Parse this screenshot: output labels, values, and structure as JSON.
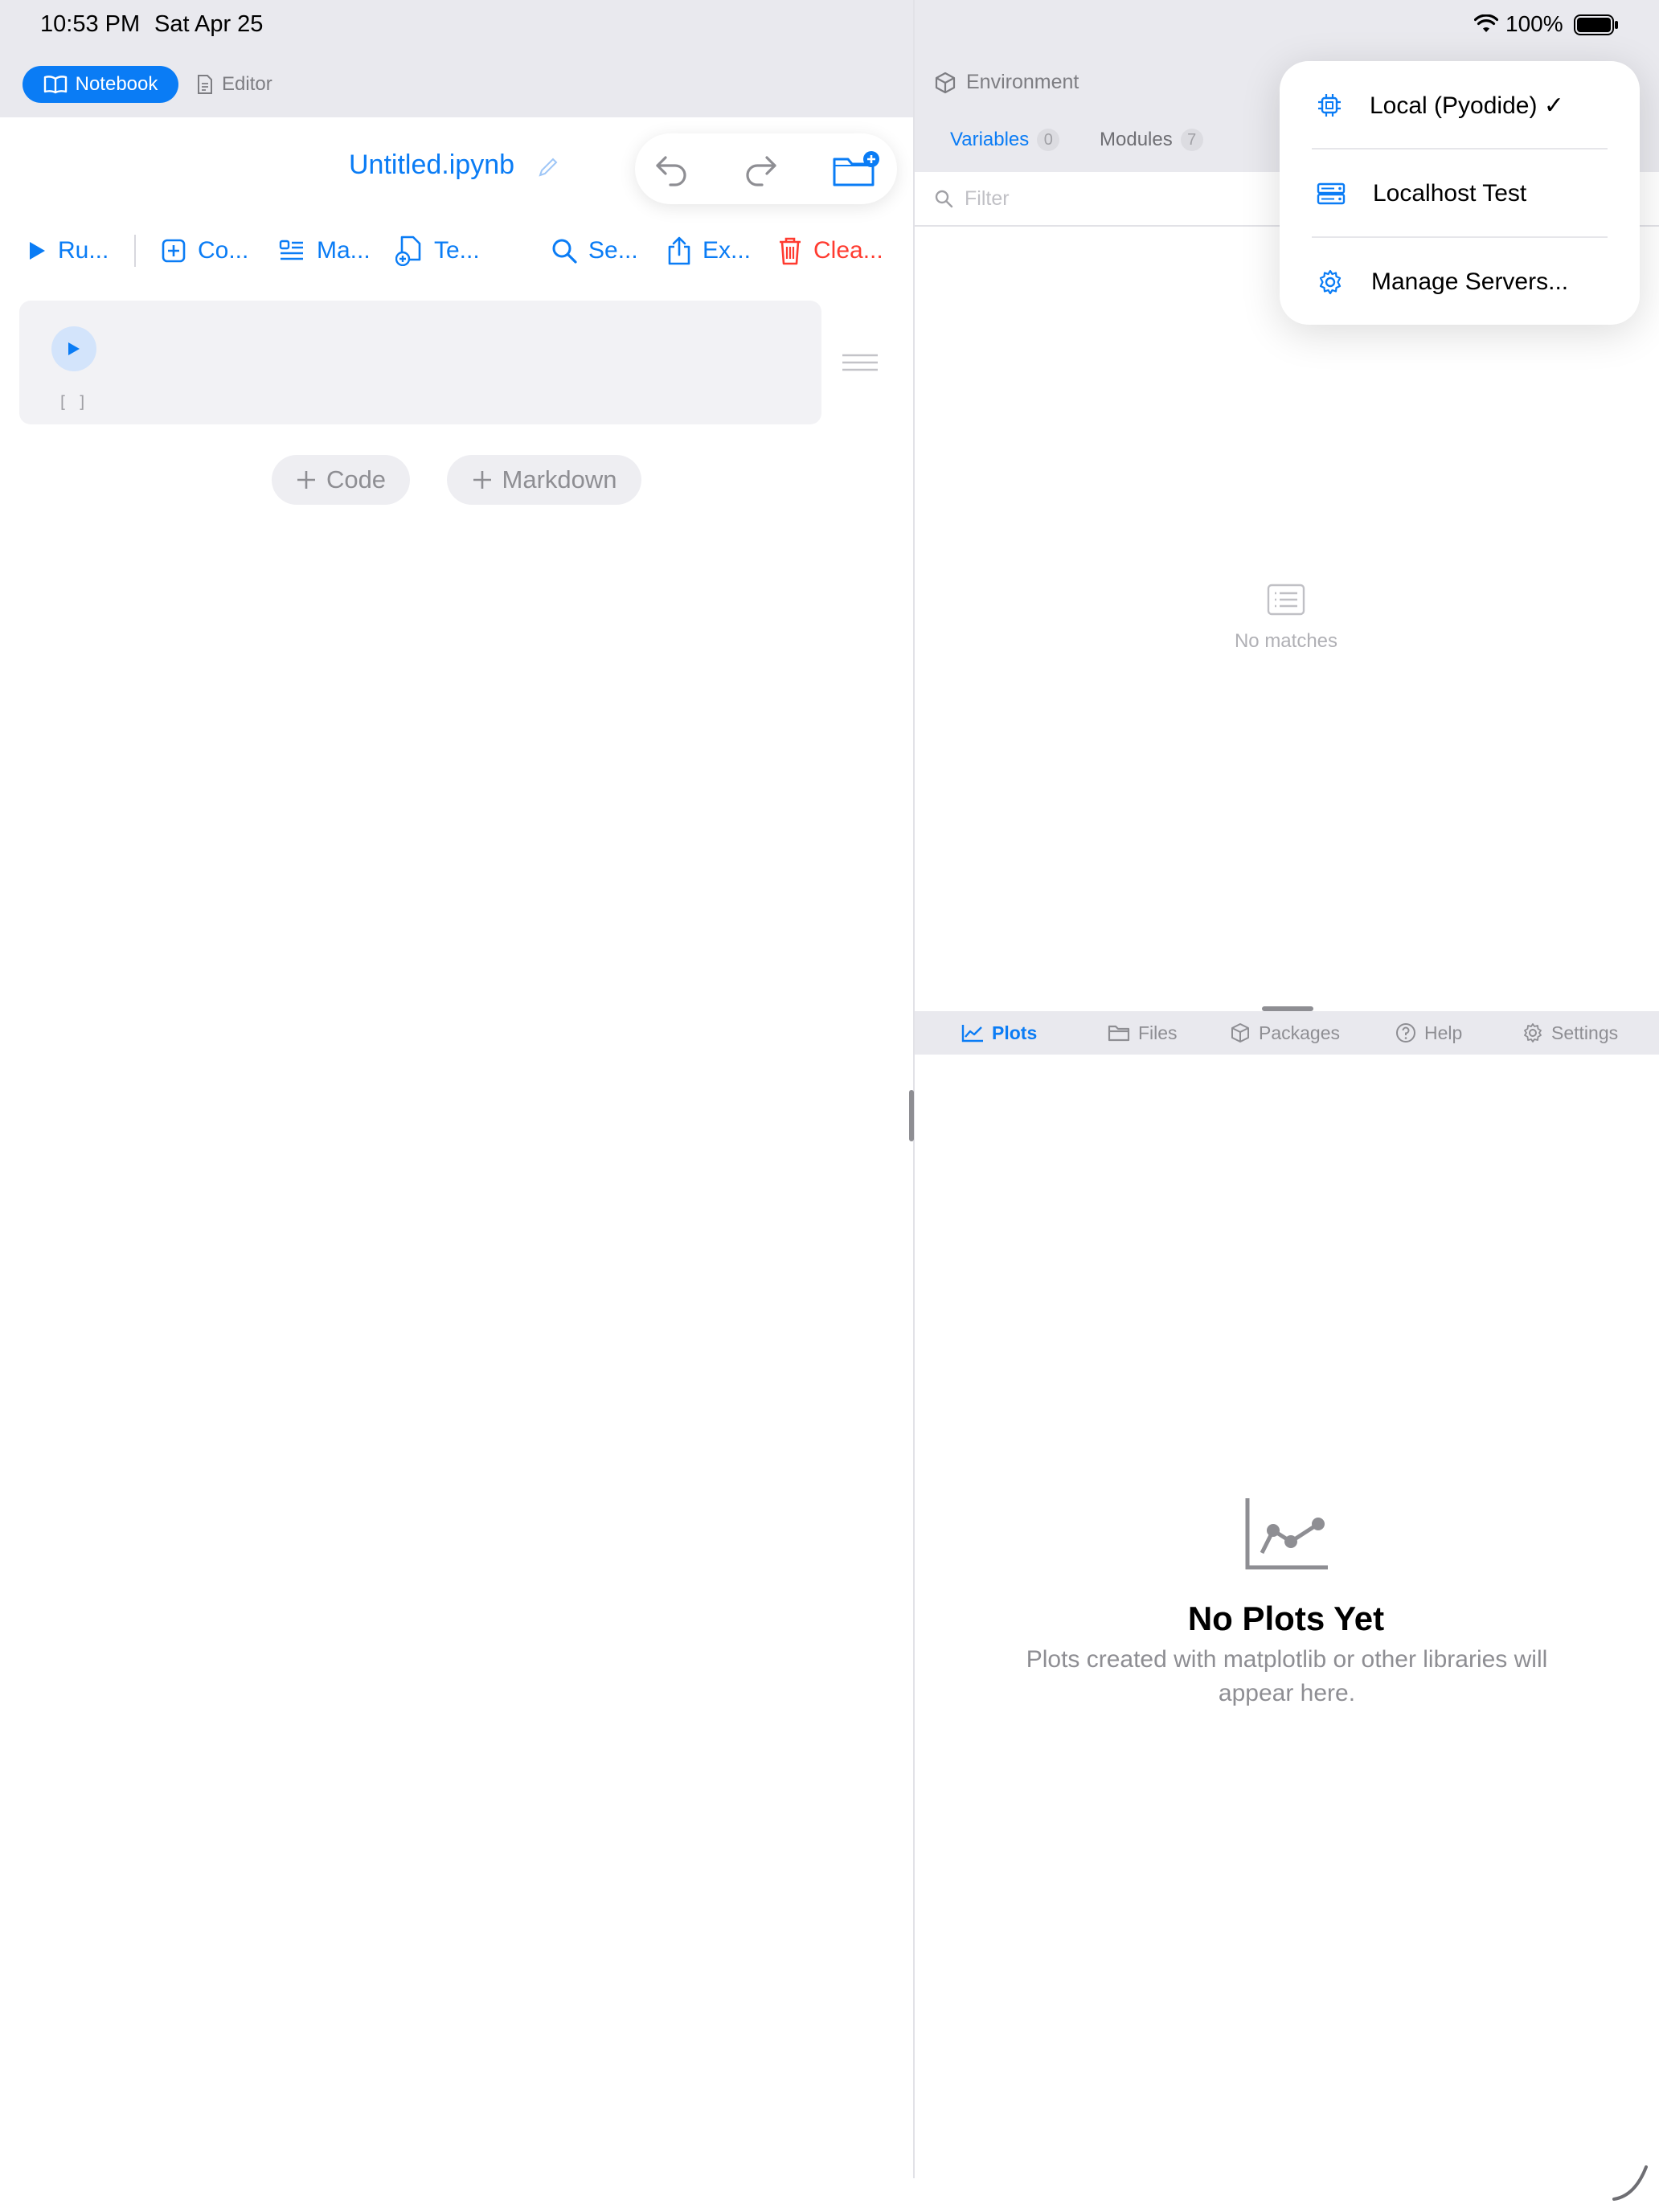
{
  "status_bar": {
    "time": "10:53 PM",
    "date": "Sat Apr 25",
    "battery": "100%"
  },
  "modes": {
    "notebook_label": "Notebook",
    "editor_label": "Editor"
  },
  "notebook": {
    "title": "Untitled.ipynb",
    "toolbar": [
      {
        "label": "Ru...",
        "icon": "play-icon"
      },
      {
        "label": "Co...",
        "icon": "add-code-cell-icon"
      },
      {
        "label": "Ma...",
        "icon": "markdown-icon"
      },
      {
        "label": "Te...",
        "icon": "template-icon"
      },
      {
        "label": "Se...",
        "icon": "search-icon"
      },
      {
        "label": "Ex...",
        "icon": "share-icon"
      },
      {
        "label": "Clea...",
        "icon": "trash-icon"
      }
    ],
    "cell": {
      "prompt": "[ ]"
    },
    "add_code_label": "Code",
    "add_markdown_label": "Markdown"
  },
  "environment": {
    "title": "Environment",
    "tabs": {
      "variables_label": "Variables",
      "variables_count": "0",
      "modules_label": "Modules",
      "modules_count": "7"
    },
    "filter_placeholder": "Filter",
    "empty_text": "No matches"
  },
  "server_menu": {
    "items": [
      {
        "label": "Local (Pyodide) ✓",
        "icon": "cpu-chip-icon"
      },
      {
        "label": "Localhost Test",
        "icon": "server-icon"
      },
      {
        "label": "Manage Servers...",
        "icon": "gear-icon"
      }
    ]
  },
  "bottom_tabs": {
    "items": [
      {
        "label": "Plots",
        "icon": "chart-icon"
      },
      {
        "label": "Files",
        "icon": "folder-icon"
      },
      {
        "label": "Packages",
        "icon": "box-icon"
      },
      {
        "label": "Help",
        "icon": "question-icon"
      },
      {
        "label": "Settings",
        "icon": "gear-icon"
      }
    ]
  },
  "plots": {
    "title": "No Plots Yet",
    "description": "Plots created with matplotlib or other libraries will appear here."
  },
  "colors": {
    "accent": "#0a7cf5",
    "destructive": "#ff3b30",
    "chrome": "#e9e9ee"
  }
}
